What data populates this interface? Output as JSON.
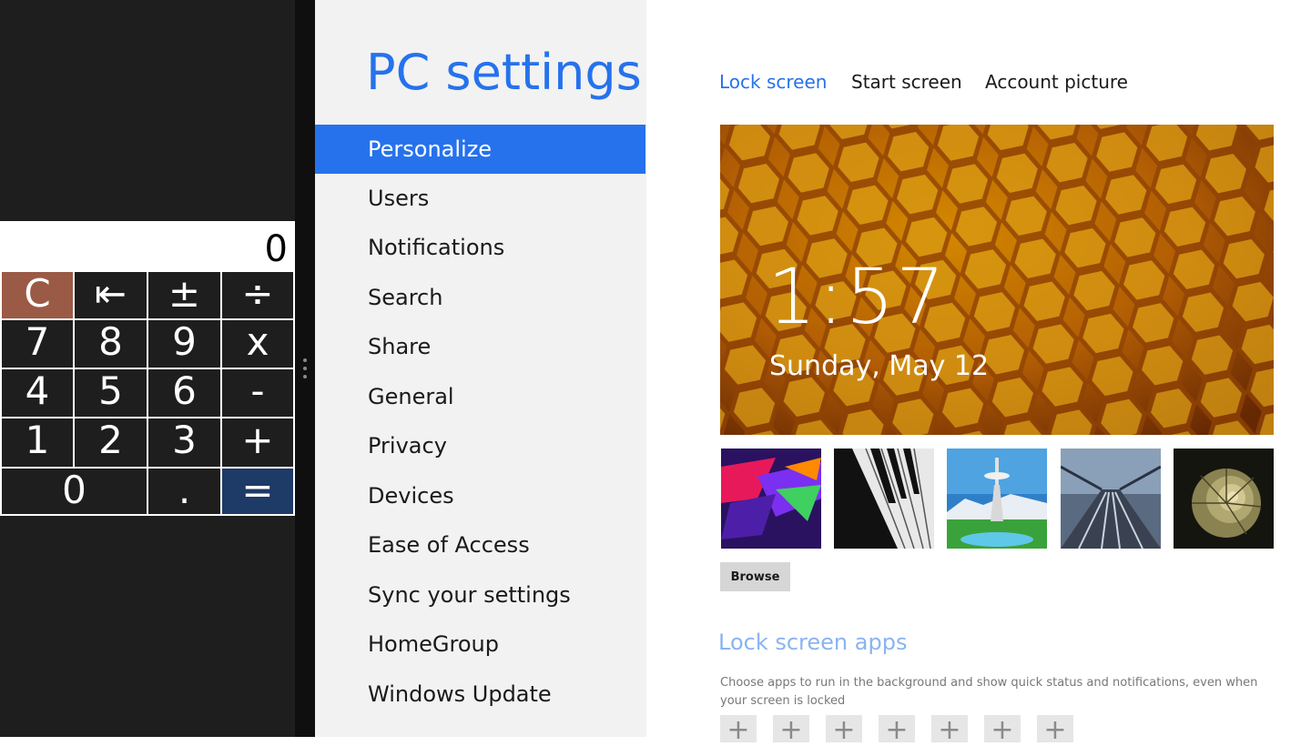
{
  "calculator": {
    "display": "0",
    "keys": {
      "clear": "C",
      "backspace": "⇤",
      "plus_minus": "±",
      "divide": "÷",
      "seven": "7",
      "eight": "8",
      "nine": "9",
      "multiply": "x",
      "four": "4",
      "five": "5",
      "six": "6",
      "minus": "-",
      "one": "1",
      "two": "2",
      "three": "3",
      "plus": "+",
      "zero": "0",
      "decimal": ".",
      "equals": "="
    }
  },
  "settings": {
    "title": "PC settings",
    "nav": [
      "Personalize",
      "Users",
      "Notifications",
      "Search",
      "Share",
      "General",
      "Privacy",
      "Devices",
      "Ease of Access",
      "Sync your settings",
      "HomeGroup",
      "Windows Update"
    ],
    "selected_index": 0
  },
  "content": {
    "tabs": [
      "Lock screen",
      "Start screen",
      "Account picture"
    ],
    "active_tab": 0,
    "lock_preview": {
      "time": "1:57",
      "date": "Sunday, May 12"
    },
    "thumbnails": [
      "abstract-colors-thumbnail",
      "piano-keys-thumbnail",
      "space-needle-thumbnail",
      "train-tracks-thumbnail",
      "nautilus-shell-thumbnail"
    ],
    "browse_label": "Browse",
    "lock_apps_title": "Lock screen apps",
    "lock_apps_desc": "Choose apps to run in the background and show quick status and notifications, even when your screen is locked",
    "add_app_symbol": "+"
  },
  "colors": {
    "accent": "#2672ec",
    "calc_clear": "#9b5a45",
    "calc_equals": "#1e3a66"
  }
}
